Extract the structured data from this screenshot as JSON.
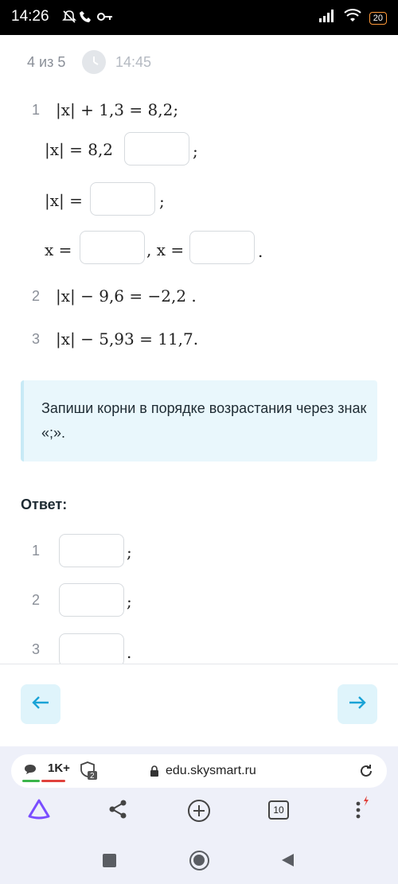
{
  "status_bar": {
    "time": "14:26",
    "battery": "20"
  },
  "header": {
    "progress": "4 из 5",
    "timer": "14:45"
  },
  "tasks": {
    "t1_num": "1",
    "t1_eq": "|x| + 1,3 = 8,2;",
    "t1_step1_left": "|x| = 8,2",
    "t1_step1_end": ";",
    "t1_step2_left": "|x| =",
    "t1_step2_end": ";",
    "t1_step3_left": "x =",
    "t1_step3_mid": ", x =",
    "t1_step3_end": ".",
    "t2_num": "2",
    "t2_eq": "|x| − 9,6 = −2,2 .",
    "t3_num": "3",
    "t3_eq": "|x| − 5,93 = 11,7."
  },
  "hint": {
    "text": "Запиши корни в порядке возрастания через знак «;»."
  },
  "answer": {
    "title": "Ответ:",
    "rows": [
      {
        "num": "1",
        "end": ";"
      },
      {
        "num": "2",
        "end": ";"
      },
      {
        "num": "3",
        "end": "."
      }
    ]
  },
  "navigation": {
    "back_icon": "arrow-left-icon",
    "forward_icon": "arrow-right-icon"
  },
  "browser": {
    "likes": "1K+",
    "tab_badge": "2",
    "url": "edu.skysmart.ru",
    "tabs_count": "10"
  },
  "colors": {
    "accent": "#1aa3d6",
    "hint_bg": "#e9f7fc",
    "nav_btn_bg": "#dff4fb",
    "alice": "#7a4dff"
  }
}
